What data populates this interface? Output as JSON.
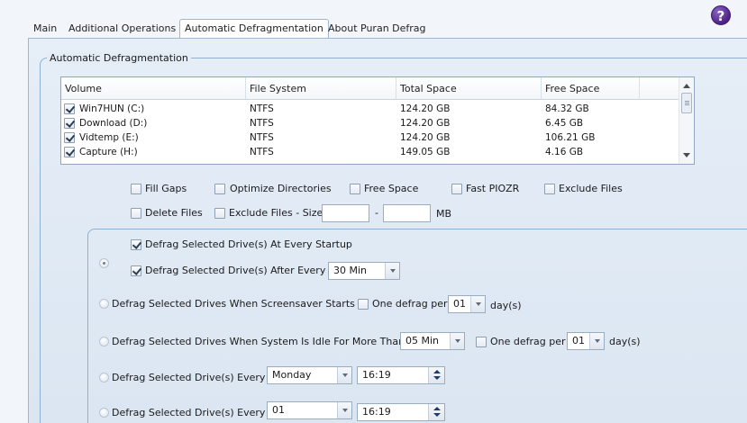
{
  "tabs": [
    {
      "label": "Main"
    },
    {
      "label": "Additional Operations"
    },
    {
      "label": "Automatic Defragmentation"
    },
    {
      "label": "About Puran Defrag"
    }
  ],
  "active_tab": "Automatic Defragmentation",
  "help_label": "?",
  "group_title": "Automatic Defragmentation",
  "drives": {
    "columns": [
      "Volume",
      "File System",
      "Total Space",
      "Free Space"
    ],
    "rows": [
      {
        "checked": true,
        "volume": "Win7HUN (C:)",
        "fs": "NTFS",
        "total": "124.20 GB",
        "free": "84.32 GB"
      },
      {
        "checked": true,
        "volume": "Download (D:)",
        "fs": "NTFS",
        "total": "124.20 GB",
        "free": "6.45 GB"
      },
      {
        "checked": true,
        "volume": "Vidtemp (E:)",
        "fs": "NTFS",
        "total": "124.20 GB",
        "free": "106.21 GB"
      },
      {
        "checked": true,
        "volume": "Capture (H:)",
        "fs": "NTFS",
        "total": "149.05 GB",
        "free": "4.16 GB"
      }
    ]
  },
  "options": {
    "fill_gaps": "Fill Gaps",
    "optimize_directories": "Optimize Directories",
    "free_space": "Free Space",
    "fast_piozr": "Fast PIOZR",
    "exclude_files": "Exclude Files",
    "delete_files": "Delete Files",
    "exclude_files_size": "Exclude Files - Size",
    "size_min": "",
    "size_max": "",
    "size_dash": "-",
    "size_unit": "MB"
  },
  "schedule": {
    "startup_label": "Defrag Selected Drive(s) At Every Startup",
    "startup_checked": true,
    "after_every_label": "Defrag Selected Drive(s) After Every",
    "after_every_checked": true,
    "after_every_value": "30 Min",
    "screensaver_label": "Defrag Selected Drives When Screensaver Starts",
    "one_defrag_per": "One defrag per",
    "screensaver_days": "01",
    "days_unit": "day(s)",
    "idle_label": "Defrag Selected Drives When System Is Idle For More Than",
    "idle_value": "05 Min",
    "idle_days": "01",
    "weekly_label": "Defrag Selected Drive(s) Every",
    "weekly_day": "Monday",
    "weekly_time": "16:19",
    "monthly_label": "Defrag Selected Drive(s) Every",
    "monthly_day": "01",
    "monthly_time": "16:19"
  }
}
